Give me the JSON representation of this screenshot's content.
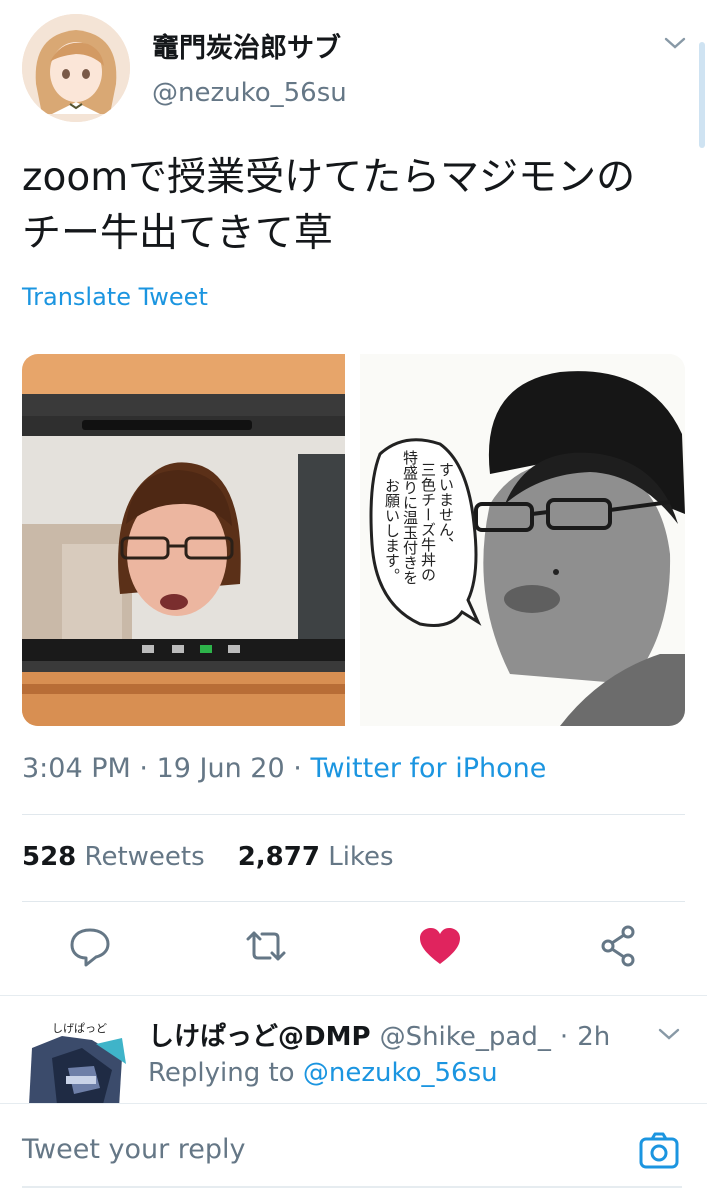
{
  "author": {
    "display_name": "竈門炭治郎サブ",
    "handle": "@nezuko_56su"
  },
  "tweet": {
    "text_line1": "zoomで授業受けてたらマジモンの",
    "text_line2": "チー牛出てきて草",
    "translate_label": "Translate Tweet"
  },
  "media": {
    "left_icon": "video-call-screenshot",
    "right_icon": "manga-drawing",
    "bubble_line1": "すいません、",
    "bubble_line2": "三色チーズ牛丼の",
    "bubble_line3": "特盛りに温玉付きを",
    "bubble_line4": "お願いします。"
  },
  "meta": {
    "time": "3:04 PM",
    "date": "19 Jun 20",
    "sep": "·",
    "source": "Twitter for iPhone"
  },
  "stats": {
    "retweets_count": "528",
    "retweets_label": "Retweets",
    "likes_count": "2,877",
    "likes_label": "Likes"
  },
  "actions": {
    "reply_icon": "reply-icon",
    "retweet_icon": "retweet-icon",
    "like_icon": "heart-icon",
    "share_icon": "share-icon",
    "like_color": "#e0245e"
  },
  "reply": {
    "avatar_text": "しげぱっど",
    "display_name": "しけぱっど@DMP",
    "handle": "@Shike_pad_",
    "sep": "·",
    "time": "2h",
    "replying_to_label": "Replying to",
    "replying_to_handle": "@nezuko_56su"
  },
  "composer": {
    "placeholder": "Tweet your reply"
  },
  "colors": {
    "link_blue": "#1b95e0",
    "secondary_text": "#657786",
    "heart_red": "#e0245e"
  }
}
